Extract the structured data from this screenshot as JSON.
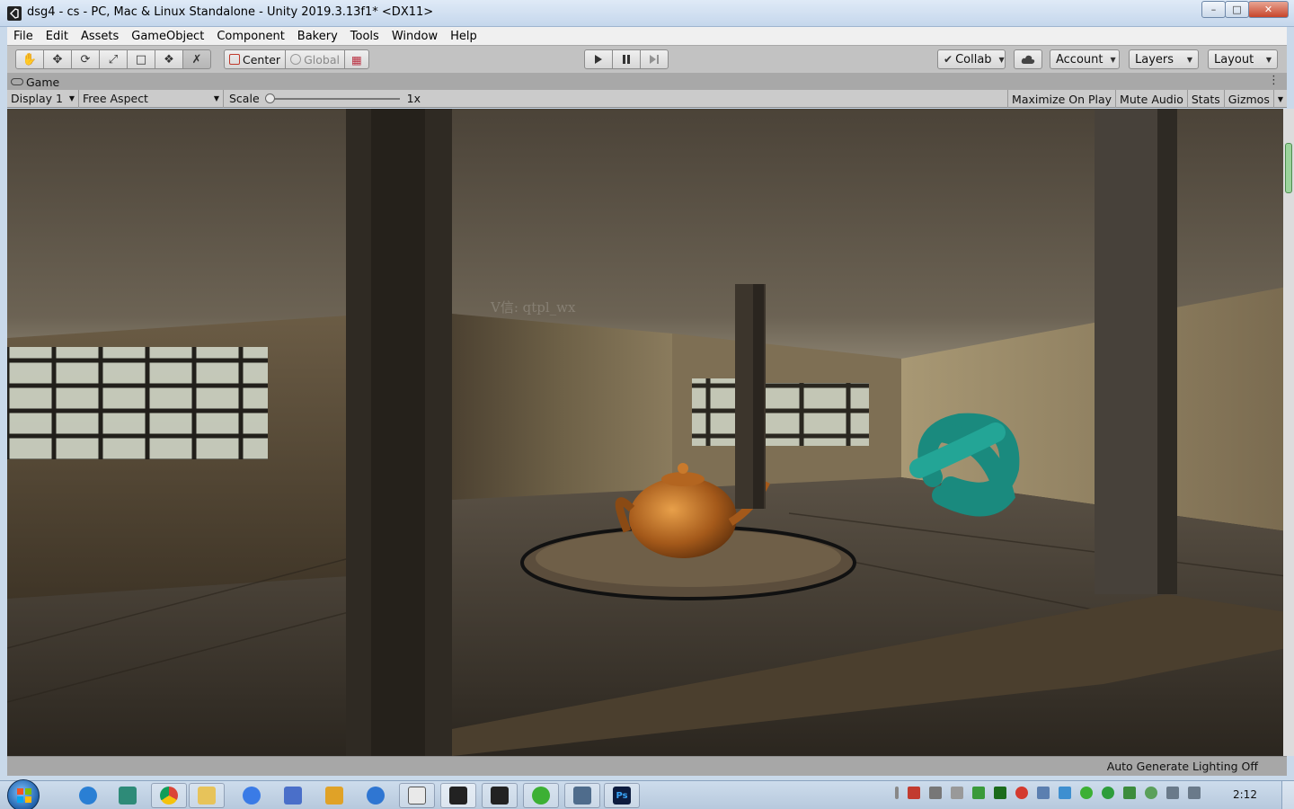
{
  "window": {
    "title": "dsg4 - cs - PC, Mac & Linux Standalone - Unity 2019.3.13f1* <DX11>",
    "minimize_icon": "minimize-icon",
    "maximize_icon": "maximize-icon",
    "close_icon": "close-icon"
  },
  "menu": [
    "File",
    "Edit",
    "Assets",
    "GameObject",
    "Component",
    "Bakery",
    "Tools",
    "Window",
    "Help"
  ],
  "toolbar": {
    "tools": [
      "hand-icon",
      "move-icon",
      "rotate-icon",
      "scale-icon",
      "rect-icon",
      "transform-icon",
      "custom-tool-icon"
    ],
    "pivot_mode": "Center",
    "pivot_rotation": "Global",
    "collab_label": "Collab",
    "cloud_icon": "cloud-icon",
    "account_label": "Account",
    "layers_label": "Layers",
    "layout_label": "Layout"
  },
  "game_tab": {
    "label": "Game",
    "icon": "gamepad-icon"
  },
  "game_toolbar": {
    "display": "Display 1",
    "aspect": "Free Aspect",
    "scale_label": "Scale",
    "scale_value": "1x",
    "maximize_on_play": "Maximize On Play",
    "mute_audio": "Mute Audio",
    "stats": "Stats",
    "gizmos": "Gizmos"
  },
  "viewport": {
    "watermark": "V信: qtpl_wx"
  },
  "status": {
    "message": "Auto Generate Lighting Off"
  },
  "taskbar": {
    "clock": "2:12",
    "apps": [
      "ie-icon",
      "app-icon",
      "chrome-icon",
      "explorer-icon",
      "baidu-icon",
      "app-icon",
      "app-icon",
      "app-icon",
      "unity-icon",
      "unity-icon",
      "unity-icon",
      "wechat-icon",
      "app-icon",
      "photoshop-icon"
    ],
    "photoshop_label": "Ps"
  }
}
